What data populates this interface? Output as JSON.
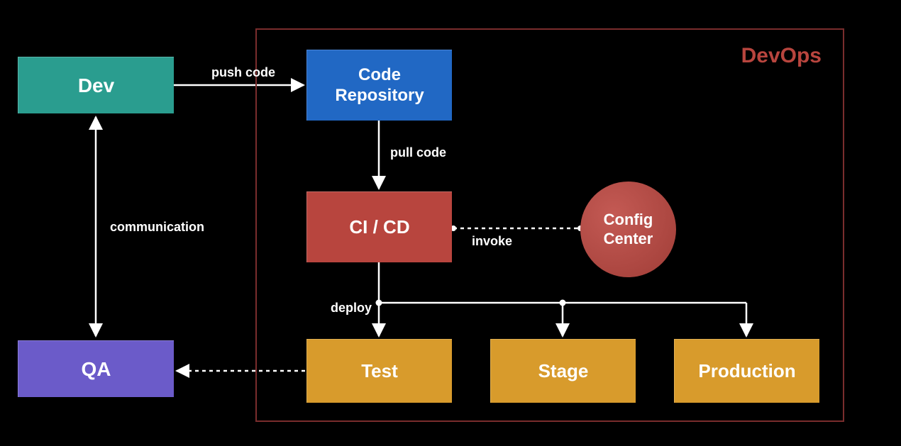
{
  "devops": {
    "title": "DevOps"
  },
  "nodes": {
    "dev": "Dev",
    "qa": "QA",
    "code_repo": "Code\nRepository",
    "cicd": "CI / CD",
    "config": "Config\nCenter",
    "test": "Test",
    "stage": "Stage",
    "production": "Production"
  },
  "labels": {
    "push": "push  code",
    "pull": "pull code",
    "invoke": "invoke",
    "communication": "communication",
    "deploy": "deploy"
  },
  "colors": {
    "dev": "#2a9d8f",
    "qa": "#6b5bc9",
    "code_repo": "#2168c4",
    "cicd": "#b8453e",
    "config": "#b8453e",
    "env": "#d89b2c",
    "frame": "#7a2d2d",
    "devops_title": "#b8453e"
  }
}
